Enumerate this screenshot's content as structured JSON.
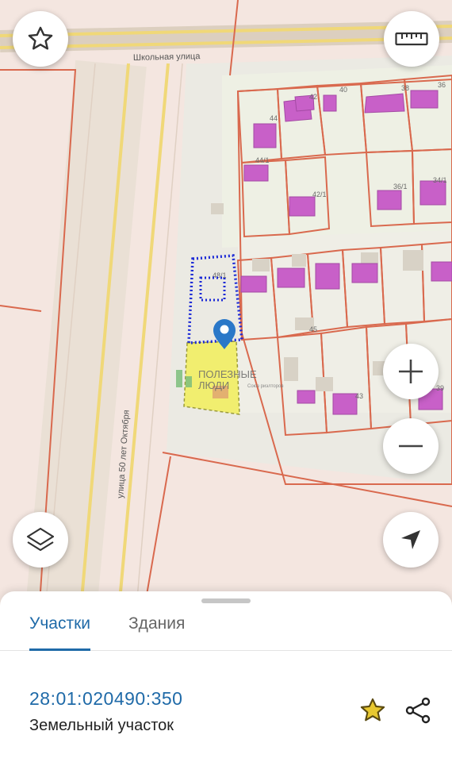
{
  "map": {
    "street_labels": {
      "school_street": "Школьная улица",
      "october_street": "улица 50 лет Октября"
    },
    "house_numbers": [
      "44",
      "42",
      "40",
      "38",
      "36",
      "44/1",
      "42/1",
      "36/1",
      "34/1",
      "48/1",
      "45",
      "43",
      "39"
    ],
    "watermark": {
      "line1": "ПОЛЕЗНЫЕ",
      "line2": "ЛЮДИ",
      "subtitle": "Союз риэлторов"
    },
    "colors": {
      "background": "#f4e6e0",
      "road_yellow": "#f0d878",
      "parcel_border": "#d9694e",
      "building_fill": "#c860c8",
      "selected_parcel": "#f2ef5a",
      "outline_blue": "#1c2ad6",
      "pin": "#2a78c8"
    }
  },
  "controls": {
    "favorite_icon": "star-outline-icon",
    "ruler_icon": "ruler-icon",
    "zoom_in_icon": "plus-icon",
    "zoom_out_icon": "minus-icon",
    "layers_icon": "layers-icon",
    "locate_icon": "navigation-arrow-icon"
  },
  "sheet": {
    "tabs": [
      "Участки",
      "Здания"
    ],
    "active_tab": "Участки",
    "cadastral_number": "28:01:020490:350",
    "parcel_type": "Земельный участок",
    "favorite_color": "#e8c830",
    "share_icon": "share-icon"
  }
}
